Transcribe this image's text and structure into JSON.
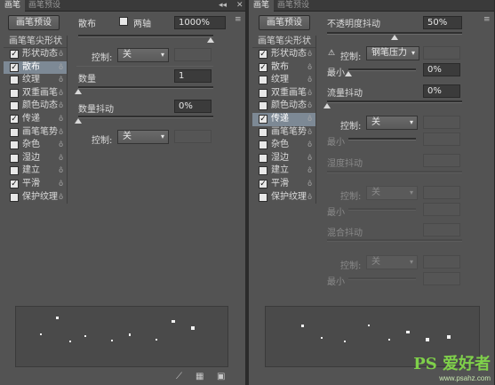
{
  "left": {
    "tabs": [
      "画笔",
      "画笔预设"
    ],
    "preset_button": "画笔预设",
    "list_header": "画笔笔尖形状",
    "items": [
      {
        "label": "形状动态",
        "checked": true,
        "selected": false
      },
      {
        "label": "散布",
        "checked": true,
        "selected": true
      },
      {
        "label": "纹理",
        "checked": false,
        "selected": false
      },
      {
        "label": "双重画笔",
        "checked": false,
        "selected": false
      },
      {
        "label": "颜色动态",
        "checked": false,
        "selected": false
      },
      {
        "label": "传递",
        "checked": true,
        "selected": false
      },
      {
        "label": "画笔笔势",
        "checked": false,
        "selected": false
      },
      {
        "label": "杂色",
        "checked": false,
        "selected": false
      },
      {
        "label": "湿边",
        "checked": false,
        "selected": false
      },
      {
        "label": "建立",
        "checked": false,
        "selected": false
      },
      {
        "label": "平滑",
        "checked": true,
        "selected": false
      },
      {
        "label": "保护纹理",
        "checked": false,
        "selected": false
      }
    ],
    "scatter_label": "散布",
    "both_axes_label": "两轴",
    "scatter_value": "1000%",
    "control_label": "控制:",
    "control_value": "关",
    "count_label": "数量",
    "count_value": "1",
    "count_jitter_label": "数量抖动",
    "count_jitter_value": "0%",
    "control2_label": "控制:",
    "control2_value": "关"
  },
  "right": {
    "tabs": [
      "画笔",
      "画笔预设"
    ],
    "preset_button": "画笔预设",
    "list_header": "画笔笔尖形状",
    "items": [
      {
        "label": "形状动态",
        "checked": true,
        "selected": false
      },
      {
        "label": "散布",
        "checked": true,
        "selected": false
      },
      {
        "label": "纹理",
        "checked": false,
        "selected": false
      },
      {
        "label": "双重画笔",
        "checked": false,
        "selected": false
      },
      {
        "label": "颜色动态",
        "checked": false,
        "selected": false
      },
      {
        "label": "传递",
        "checked": true,
        "selected": true
      },
      {
        "label": "画笔笔势",
        "checked": false,
        "selected": false
      },
      {
        "label": "杂色",
        "checked": false,
        "selected": false
      },
      {
        "label": "湿边",
        "checked": false,
        "selected": false
      },
      {
        "label": "建立",
        "checked": false,
        "selected": false
      },
      {
        "label": "平滑",
        "checked": true,
        "selected": false
      },
      {
        "label": "保护纹理",
        "checked": false,
        "selected": false
      }
    ],
    "opacity_jitter_label": "不透明度抖动",
    "opacity_jitter_value": "50%",
    "control_label": "控制:",
    "control_value": "钢笔压力",
    "min_label": "最小",
    "min_value": "0%",
    "flow_jitter_label": "流量抖动",
    "flow_jitter_value": "0%",
    "control2_label": "控制:",
    "control2_value": "关",
    "min2_label": "最小",
    "wetness_label": "湿度抖动",
    "control3_label": "控制:",
    "control3_value": "关",
    "min3_label": "最小",
    "mix_label": "混合抖动",
    "control4_label": "控制:",
    "control4_value": "关",
    "min4_label": "最小"
  },
  "watermark": {
    "text": "PS 爱好者",
    "url": "www.psahz.com"
  },
  "icons": {
    "collapse": "double-chevron-left-icon",
    "menu": "menu-icon",
    "lock": "lock-icon",
    "warning": "warning-icon"
  }
}
